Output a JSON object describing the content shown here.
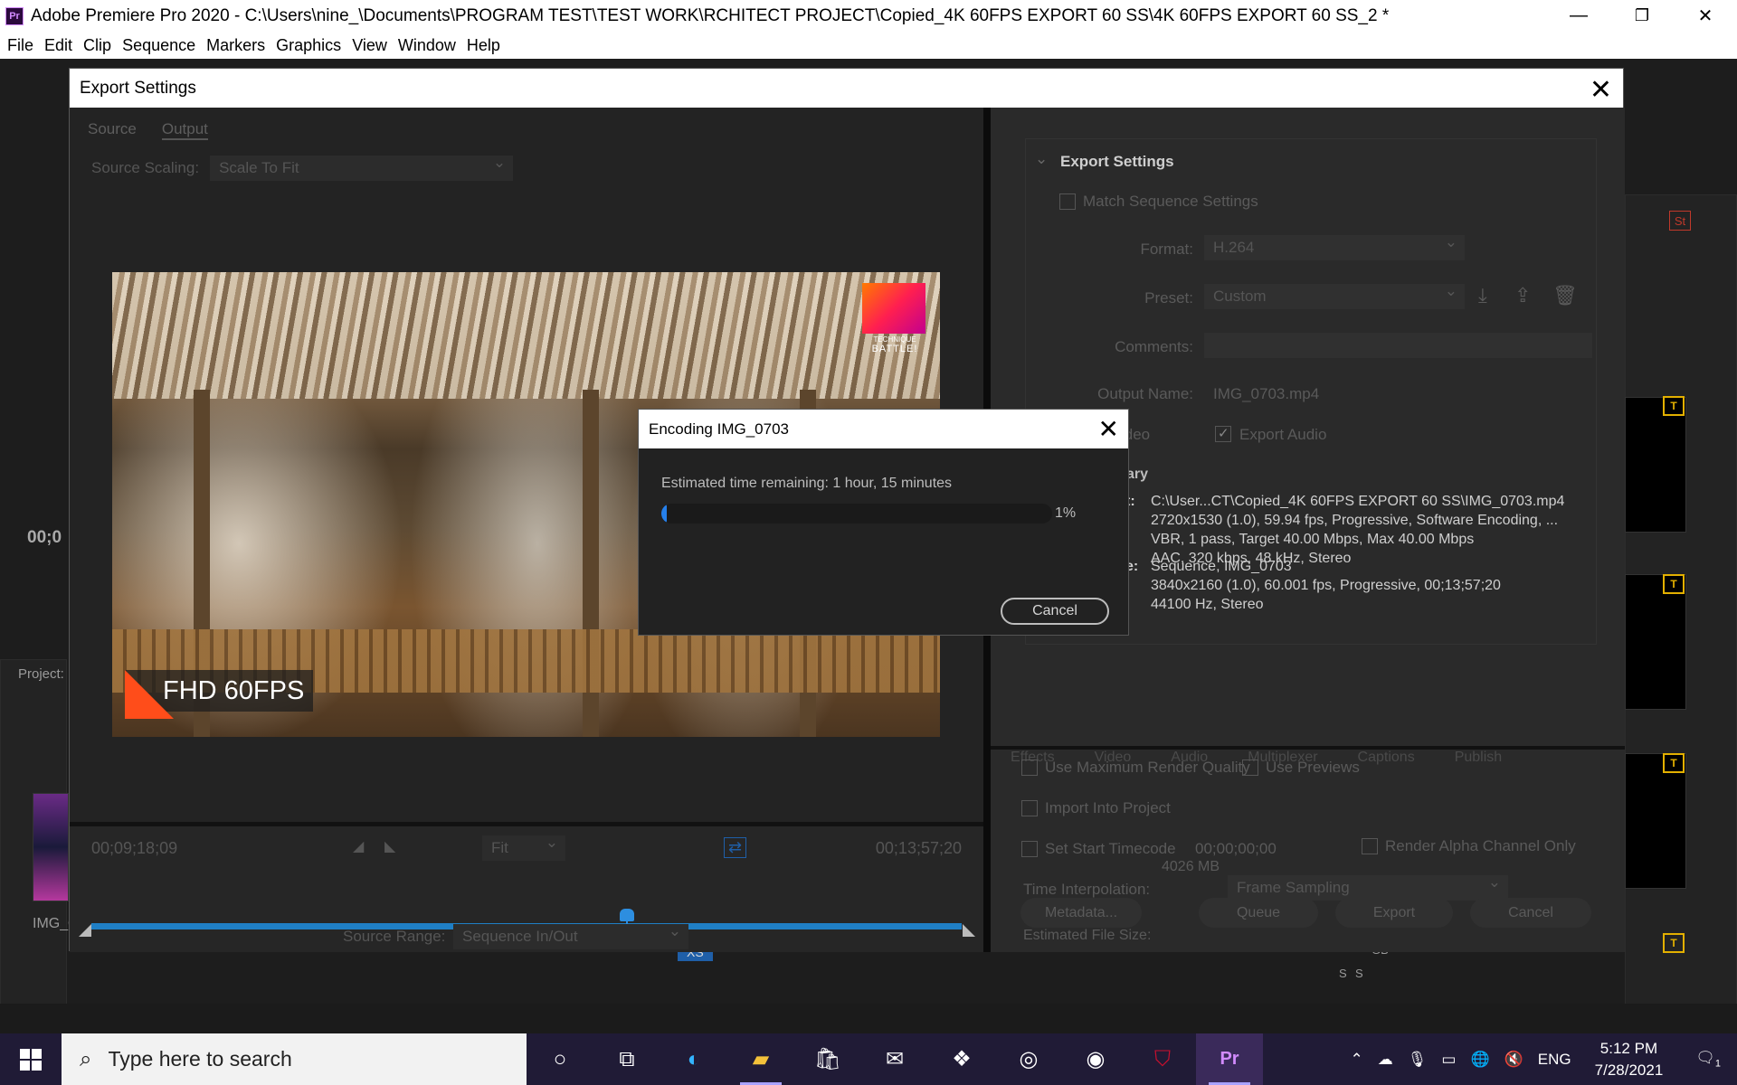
{
  "window": {
    "title": "Adobe Premiere Pro 2020 - C:\\Users\\nine_\\Documents\\PROGRAM TEST\\TEST WORK\\RCHITECT PROJECT\\Copied_4K 60FPS EXPORT 60 SS\\4K 60FPS EXPORT 60 SS_2 *",
    "app_icon": "Pr",
    "minimize": "—",
    "restore": "❐",
    "close": "✕"
  },
  "menu": [
    "File",
    "Edit",
    "Clip",
    "Sequence",
    "Markers",
    "Graphics",
    "View",
    "Window",
    "Help"
  ],
  "background": {
    "project_label": "Project:",
    "project_item": "IMG_0",
    "timecode_fragment": "00;0",
    "st_badge": "St",
    "xr_label": "XS",
    "ss_labels": [
      "S",
      "S"
    ],
    "gb_label": "GB"
  },
  "export_dialog": {
    "title": "Export Settings",
    "close": "✕",
    "tabs": [
      "Source",
      "Output"
    ],
    "source_scaling_label": "Source Scaling:",
    "source_scaling_value": "Scale To Fit",
    "preview": {
      "brand_small": "TECHNIQUE",
      "brand_big": "BATTLE!",
      "fhd_text": "FHD 60FPS"
    },
    "timecode_in": "00;09;18;09",
    "timecode_out": "00;13;57;20",
    "fit_value": "Fit",
    "playhead_fraction": 0.615,
    "source_range_label": "Source Range:",
    "source_range_value": "Sequence In/Out",
    "settings": {
      "header": "Export Settings",
      "match_sequence": "Match Sequence Settings",
      "format_label": "Format:",
      "format_value": "H.264",
      "preset_label": "Preset:",
      "preset_value": "Custom",
      "comments_label": "Comments:",
      "output_name_label": "Output Name:",
      "output_name_value": "IMG_0703.mp4",
      "export_video_frag": "ideo",
      "export_audio": "Export Audio",
      "summary_frag": "ary",
      "output_key_frag": "t:",
      "output_lines": [
        "C:\\User...CT\\Copied_4K 60FPS EXPORT 60 SS\\IMG_0703.mp4",
        "2720x1530 (1.0), 59.94 fps, Progressive, Software Encoding, ...",
        "VBR, 1 pass, Target 40.00 Mbps, Max 40.00 Mbps",
        "AAC, 320 kbps, 48 kHz, Stereo"
      ],
      "source_key_frag": "e:",
      "source_lines": [
        "Sequence, IMG_0703",
        "3840x2160 (1.0), 60.001 fps, Progressive, 00;13;57;20",
        "44100 Hz, Stereo"
      ],
      "subtabs": [
        "Effects",
        "Video",
        "Audio",
        "Multiplexer",
        "Captions",
        "Publish"
      ],
      "use_max_render": "Use Maximum Render Quality",
      "use_previews": "Use Previews",
      "import_into_project": "Import Into Project",
      "set_start_timecode": "Set Start Timecode",
      "start_timecode_value": "00;00;00;00",
      "render_alpha": "Render Alpha Channel Only",
      "time_interp_label": "Time Interpolation:",
      "time_interp_value": "Frame Sampling",
      "est_size_label": "Estimated File Size:",
      "est_size_value": "4026 MB",
      "btn_metadata": "Metadata...",
      "btn_queue": "Queue",
      "btn_export": "Export",
      "btn_cancel": "Cancel"
    }
  },
  "encoding": {
    "title": "Encoding IMG_0703",
    "close": "✕",
    "eta": "Estimated time remaining: 1 hour, 15 minutes",
    "progress_percent": 1,
    "percent_label": "1%",
    "cancel": "Cancel"
  },
  "taskbar": {
    "search_placeholder": "Type here to search",
    "language": "ENG",
    "time": "5:12 PM",
    "date": "7/28/2021",
    "notification_count": "1",
    "apps": [
      "cortana-icon",
      "task-view-icon",
      "edge-icon",
      "file-explorer-icon",
      "store-icon",
      "mail-icon",
      "dropbox-icon",
      "app-icon",
      "steam-icon",
      "mcafee-icon",
      "premiere-icon"
    ]
  },
  "colors": {
    "accent_blue": "#2680eb",
    "timeline_blue": "#1f7fc5",
    "taskbar": "#201b36",
    "warning": "#e3b000"
  }
}
